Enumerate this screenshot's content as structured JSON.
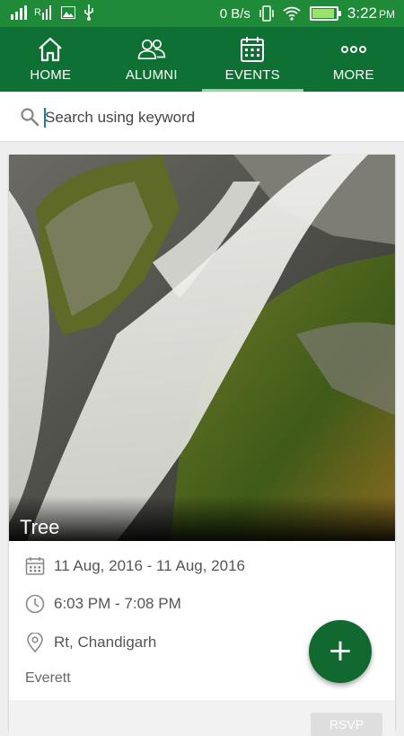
{
  "status_bar": {
    "net_speed": "0 B/s",
    "time": "3:22",
    "ampm": "PM",
    "icons": [
      "signal-icon",
      "signal-r-icon",
      "image-icon",
      "usb-icon",
      "vibrate-icon",
      "wifi-icon",
      "battery-charging-icon"
    ]
  },
  "nav": {
    "items": [
      {
        "label": "HOME",
        "icon": "home-icon"
      },
      {
        "label": "ALUMNI",
        "icon": "people-icon"
      },
      {
        "label": "EVENTS",
        "icon": "calendar-icon",
        "active": true
      },
      {
        "label": "MORE",
        "icon": "more-dots-icon"
      }
    ]
  },
  "search": {
    "placeholder": "Search using keyword"
  },
  "event": {
    "title": "Tree",
    "date": "11 Aug, 2016 - 11 Aug, 2016",
    "time": "6:03 PM - 7:08 PM",
    "location": "Rt, Chandigarh",
    "host": "Everett",
    "rsvp_label": "RSVP"
  },
  "fab": {
    "label": "+"
  },
  "colors": {
    "status_bar": "#1f8a37",
    "nav_bg": "#0f7033",
    "fab_bg": "#12692f",
    "active_underline": "#9ad39f"
  }
}
